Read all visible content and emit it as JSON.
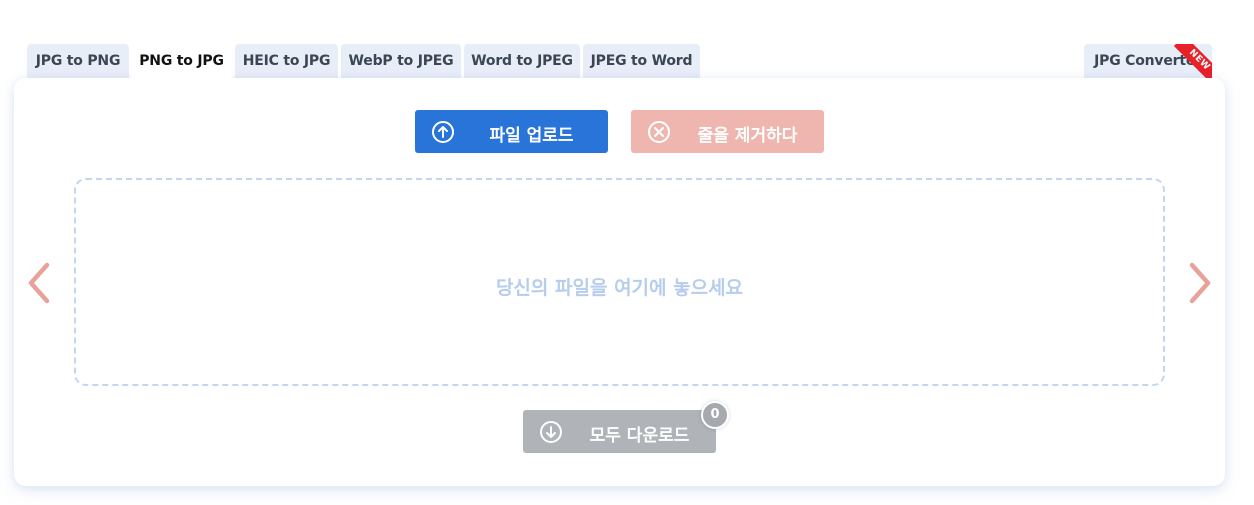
{
  "tabs": [
    {
      "label": "JPG to PNG",
      "active": false
    },
    {
      "label": "PNG to JPG",
      "active": true
    },
    {
      "label": "HEIC to JPG",
      "active": false
    },
    {
      "label": "WebP to JPEG",
      "active": false
    },
    {
      "label": "Word to JPEG",
      "active": false
    },
    {
      "label": "JPEG to Word",
      "active": false
    }
  ],
  "right_tab": {
    "label": "JPG Converter",
    "ribbon": "NEW"
  },
  "toolbar": {
    "upload_label": "파일 업로드",
    "remove_label": "줄을 제거하다"
  },
  "drop_zone": {
    "text": "당신의 파일을 여기에 놓으세요"
  },
  "download": {
    "label": "모두 다운로드",
    "count": "0"
  },
  "icons": {
    "upload": "arrow-up-circle-icon",
    "remove": "x-circle-icon",
    "download": "arrow-down-circle-icon",
    "prev": "chevron-left-icon",
    "next": "chevron-right-icon"
  },
  "colors": {
    "upload": "#2874d9",
    "remove": "#eeb6ae",
    "download": "#b0b3b7",
    "arrow": "#e8a29a",
    "drop_border": "#c3d6f1",
    "drop_text": "#b6cdee",
    "ribbon": "#e8202a"
  }
}
